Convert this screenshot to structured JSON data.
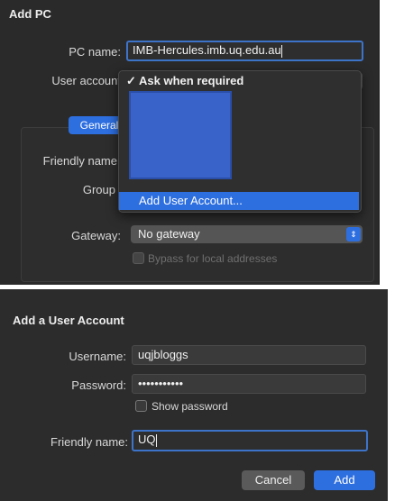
{
  "add_pc": {
    "title": "Add PC",
    "pc_name_label": "PC name:",
    "pc_name_value": "IMB-Hercules.imb.uq.edu.au",
    "user_account_label": "User account",
    "tab_general": "General",
    "friendly_name_label": "Friendly name",
    "group_label": "Group",
    "gateway_label": "Gateway:",
    "gateway_value": "No gateway",
    "bypass_label": "Bypass for local addresses",
    "dropdown": {
      "selected_check": "✓",
      "selected_label": "Ask when required",
      "add_user_account": "Add User Account..."
    }
  },
  "add_user_account": {
    "title": "Add a User Account",
    "username_label": "Username:",
    "username_value": "uqjbloggs",
    "password_label": "Password:",
    "password_value": "•••••••••••",
    "show_password_label": "Show password",
    "friendly_name_label": "Friendly name:",
    "friendly_name_value": "UQ",
    "cancel_label": "Cancel",
    "add_label": "Add"
  },
  "colors": {
    "accent": "#2e6fe0",
    "panel_bg": "#2a2a2a",
    "focus_ring": "#3d74c9"
  }
}
